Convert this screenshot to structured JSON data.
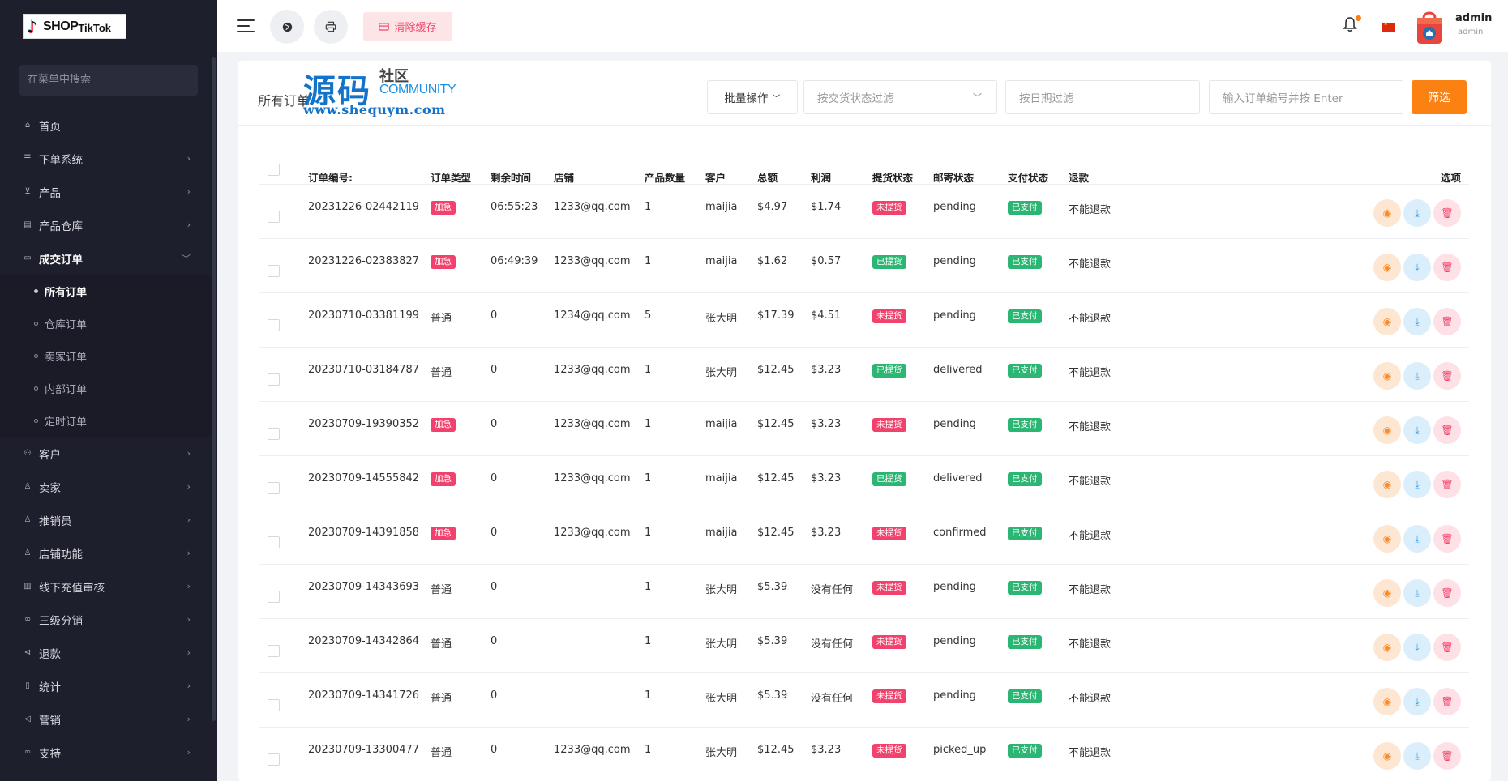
{
  "brand": {
    "logo_text_1": "SHOP",
    "logo_text_2": "TikTok"
  },
  "sidebar": {
    "search_placeholder": "在菜单中搜索",
    "items": [
      {
        "label": "首页",
        "icon": "home-icon",
        "has_children": false
      },
      {
        "label": "下单系统",
        "icon": "list-icon",
        "has_children": true
      },
      {
        "label": "产品",
        "icon": "cart-icon",
        "has_children": true
      },
      {
        "label": "产品仓库",
        "icon": "warehouse-icon",
        "has_children": true
      },
      {
        "label": "成交订单",
        "icon": "card-icon",
        "has_children": true,
        "expanded": true
      }
    ],
    "sub_items": [
      {
        "label": "所有订单",
        "active": true
      },
      {
        "label": "仓库订单",
        "active": false
      },
      {
        "label": "卖家订单",
        "active": false
      },
      {
        "label": "内部订单",
        "active": false
      },
      {
        "label": "定时订单",
        "active": false
      }
    ],
    "items_after": [
      {
        "label": "客户",
        "icon": "users-icon"
      },
      {
        "label": "卖家",
        "icon": "user-icon"
      },
      {
        "label": "推销员",
        "icon": "user-icon"
      },
      {
        "label": "店铺功能",
        "icon": "user-icon"
      },
      {
        "label": "线下充值审核",
        "icon": "barcode-icon"
      },
      {
        "label": "三级分销",
        "icon": "link-icon"
      },
      {
        "label": "退款",
        "icon": "refund-icon"
      },
      {
        "label": "统计",
        "icon": "doc-icon"
      },
      {
        "label": "营销",
        "icon": "megaphone-icon"
      },
      {
        "label": "支持",
        "icon": "link-icon"
      }
    ]
  },
  "topbar": {
    "clear_cache_label": "清除缓存",
    "user_name": "admin",
    "user_role": "admin"
  },
  "page": {
    "title": "所有订单",
    "batch_label": "批量操作",
    "status_filter_placeholder": "按交货状态过滤",
    "date_filter_placeholder": "按日期过滤",
    "order_search_placeholder": "输入订单编号并按 Enter",
    "filter_button": "筛选"
  },
  "watermark": {
    "big": "源码",
    "small": "社区",
    "community": "COMMUNITY",
    "url": "www.shequym.com"
  },
  "table": {
    "headers": [
      "订单编号:",
      "订单类型",
      "剩余时间",
      "店铺",
      "产品数量",
      "客户",
      "总额",
      "利润",
      "提货状态",
      "邮寄状态",
      "支付状态",
      "退款",
      "选项"
    ],
    "rows": [
      {
        "order_no": "20231226-02442119",
        "type": "加急",
        "type_badge": true,
        "remaining": "06:55:23",
        "shop": "1233@qq.com",
        "qty": "1",
        "customer": "maijia",
        "total": "$4.97",
        "profit": "$1.74",
        "pickup": "未提货",
        "mail": "pending",
        "pay": "已支付",
        "refund": "不能退款"
      },
      {
        "order_no": "20231226-02383827",
        "type": "加急",
        "type_badge": true,
        "remaining": "06:49:39",
        "shop": "1233@qq.com",
        "qty": "1",
        "customer": "maijia",
        "total": "$1.62",
        "profit": "$0.57",
        "pickup": "已提货",
        "mail": "pending",
        "pay": "已支付",
        "refund": "不能退款"
      },
      {
        "order_no": "20230710-03381199",
        "type": "普通",
        "type_badge": false,
        "remaining": "0",
        "shop": "1234@qq.com",
        "qty": "5",
        "customer": "张大明",
        "total": "$17.39",
        "profit": "$4.51",
        "pickup": "未提货",
        "mail": "pending",
        "pay": "已支付",
        "refund": "不能退款"
      },
      {
        "order_no": "20230710-03184787",
        "type": "普通",
        "type_badge": false,
        "remaining": "0",
        "shop": "1233@qq.com",
        "qty": "1",
        "customer": "张大明",
        "total": "$12.45",
        "profit": "$3.23",
        "pickup": "已提货",
        "mail": "delivered",
        "pay": "已支付",
        "refund": "不能退款"
      },
      {
        "order_no": "20230709-19390352",
        "type": "加急",
        "type_badge": true,
        "remaining": "0",
        "shop": "1233@qq.com",
        "qty": "1",
        "customer": "maijia",
        "total": "$12.45",
        "profit": "$3.23",
        "pickup": "未提货",
        "mail": "pending",
        "pay": "已支付",
        "refund": "不能退款"
      },
      {
        "order_no": "20230709-14555842",
        "type": "加急",
        "type_badge": true,
        "remaining": "0",
        "shop": "1233@qq.com",
        "qty": "1",
        "customer": "maijia",
        "total": "$12.45",
        "profit": "$3.23",
        "pickup": "已提货",
        "mail": "delivered",
        "pay": "已支付",
        "refund": "不能退款"
      },
      {
        "order_no": "20230709-14391858",
        "type": "加急",
        "type_badge": true,
        "remaining": "0",
        "shop": "1233@qq.com",
        "qty": "1",
        "customer": "maijia",
        "total": "$12.45",
        "profit": "$3.23",
        "pickup": "未提货",
        "mail": "confirmed",
        "pay": "已支付",
        "refund": "不能退款"
      },
      {
        "order_no": "20230709-14343693",
        "type": "普通",
        "type_badge": false,
        "remaining": "0",
        "shop": "",
        "qty": "1",
        "customer": "张大明",
        "total": "$5.39",
        "profit": "没有任何",
        "pickup": "未提货",
        "mail": "pending",
        "pay": "已支付",
        "refund": "不能退款"
      },
      {
        "order_no": "20230709-14342864",
        "type": "普通",
        "type_badge": false,
        "remaining": "0",
        "shop": "",
        "qty": "1",
        "customer": "张大明",
        "total": "$5.39",
        "profit": "没有任何",
        "pickup": "未提货",
        "mail": "pending",
        "pay": "已支付",
        "refund": "不能退款"
      },
      {
        "order_no": "20230709-14341726",
        "type": "普通",
        "type_badge": false,
        "remaining": "0",
        "shop": "",
        "qty": "1",
        "customer": "张大明",
        "total": "$5.39",
        "profit": "没有任何",
        "pickup": "未提货",
        "mail": "pending",
        "pay": "已支付",
        "refund": "不能退款"
      },
      {
        "order_no": "20230709-13300477",
        "type": "普通",
        "type_badge": false,
        "remaining": "0",
        "shop": "1233@qq.com",
        "qty": "1",
        "customer": "张大明",
        "total": "$12.45",
        "profit": "$3.23",
        "pickup": "未提货",
        "mail": "picked_up",
        "pay": "已支付",
        "refund": "不能退款"
      }
    ]
  },
  "colors": {
    "sidebar_bg": "#1e1f2c",
    "accent_orange": "#fb8112",
    "badge_red": "#f1416c",
    "badge_green": "#2bb673"
  }
}
